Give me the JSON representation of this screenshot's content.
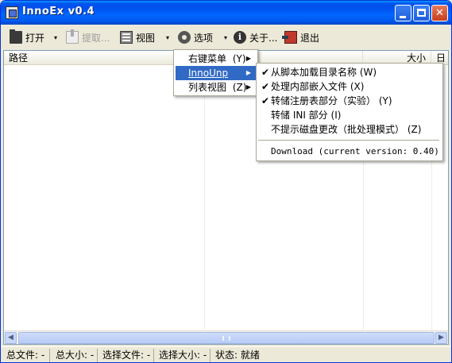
{
  "window": {
    "title": "InnoEx v0.4",
    "minimize_label": "_",
    "close_label": "✕"
  },
  "toolbar": {
    "open_label": "打开",
    "extract_label": "提取...",
    "view_label": "视图",
    "options_label": "选项",
    "about_label": "关于...",
    "exit_label": "退出",
    "dropdown_arrow": "▾",
    "about_icon_text": "i"
  },
  "list": {
    "columns": [
      "路径",
      "大小",
      "日"
    ]
  },
  "scrollbar": {
    "left_arrow": "◀",
    "right_arrow": "▶"
  },
  "statusbar": {
    "total_files": "总文件: -",
    "total_size": "总大小: -",
    "selected_files": "选择文件: -",
    "selected_size": "选择大小: -",
    "status": "状态: 就绪"
  },
  "options_menu": {
    "items": [
      {
        "label": "右键菜单",
        "accel": "(Y)",
        "accel_key": "Y"
      },
      {
        "label": "InnoUnp",
        "highlighted": true
      },
      {
        "label": "列表视图",
        "accel": "(Z)",
        "accel_key": "Z"
      }
    ],
    "submenu_arrow": "▶"
  },
  "innounp_submenu": {
    "check_mark": "✔",
    "items": [
      {
        "label": "从脚本加载目录名称",
        "accel": "(W)",
        "checked": true
      },
      {
        "label": "处理内部嵌入文件",
        "accel": "(X)",
        "checked": true
      },
      {
        "label": "转储注册表部分（实验）",
        "accel": "(Y)",
        "checked": true
      },
      {
        "label": "转储 INI 部分",
        "accel": "(I)",
        "checked": false
      },
      {
        "label": "不提示磁盘更改（批处理模式）",
        "accel": "(Z)",
        "checked": false
      }
    ],
    "download_label": "Download (current version: 0.40)"
  }
}
